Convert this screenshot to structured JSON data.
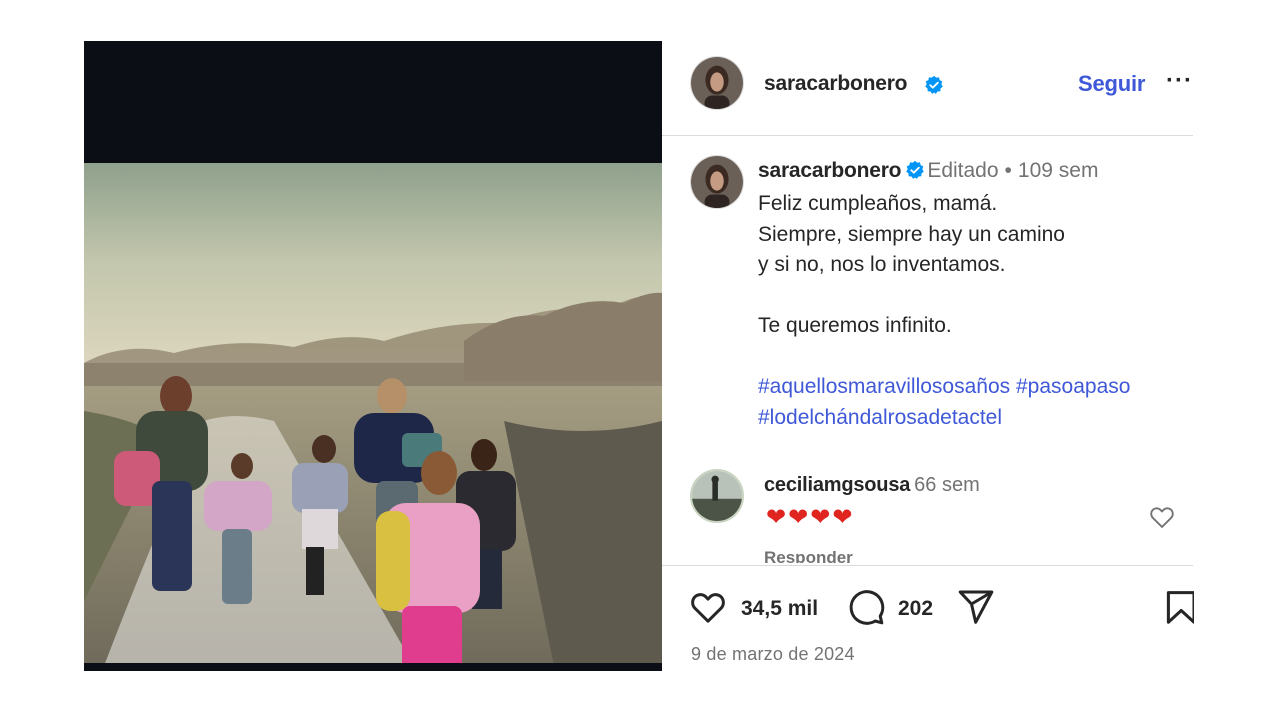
{
  "post": {
    "username": "saracarbonero",
    "follow_label": "Seguir",
    "more_label": "···",
    "edited_label": "Editado",
    "separator": "•",
    "time_ago": "109 sem",
    "caption_lines": [
      "Feliz cumpleaños, mamá.",
      "Siempre, siempre hay un camino",
      "y si no, nos lo inventamos.",
      "",
      "Te queremos infinito.",
      ""
    ],
    "hashtag_lines": [
      [
        "#aquellosmaravillososaños",
        "#pasoapaso"
      ],
      [
        "#lodelchándalrosadetactel"
      ]
    ],
    "likes": "34,5 mil",
    "comments": "202",
    "date": "9 de marzo de 2024"
  },
  "comment": {
    "username": "ceciliamgsousa",
    "time_ago": "66 sem",
    "text": "❤❤❤❤",
    "reply_label": "Responder"
  },
  "colors": {
    "link_blue": "#3f58d8",
    "verified_blue": "#0095f6",
    "muted_gray": "#737373",
    "heart_red": "#e0241f"
  },
  "icons": {
    "verified": "verified-badge-icon",
    "like": "heart-outline-icon",
    "comment": "speech-bubble-icon",
    "share": "paper-plane-icon",
    "save": "bookmark-icon"
  }
}
